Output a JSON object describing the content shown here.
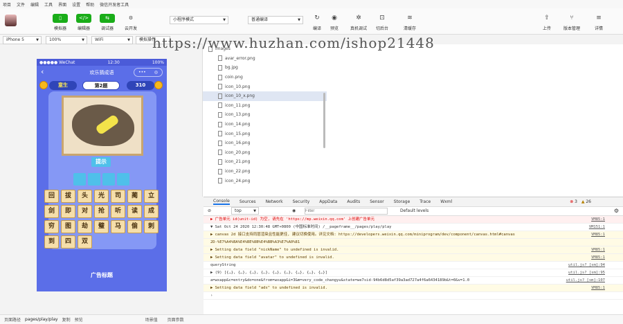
{
  "menu": [
    "项目",
    "文件",
    "编辑",
    "工具",
    "界面",
    "设置",
    "帮助",
    "微信开发者工具"
  ],
  "toolbar": {
    "simulator": "模拟器",
    "editor": "编辑器",
    "debugger": "调试器",
    "cloud": "云开发",
    "mode": "小程序模式",
    "compile_mode": "普通编译",
    "compile": "编译",
    "preview": "预览",
    "real_debug": "真机调试",
    "cut_bg": "切后台",
    "clear_cache": "清缓存",
    "upload": "上传",
    "version": "版本管理",
    "details": "详情"
  },
  "sim_bar": {
    "device": "iPhone 5",
    "zoom": "100%",
    "network": "WiFi",
    "mode": "模拟操作"
  },
  "phone": {
    "carrier": "●●●●● WeChat",
    "time": "12:30",
    "battery": "100%",
    "title": "欢乐猜成语",
    "level_name": "童生",
    "level": "第2题",
    "coins": "310",
    "hint": "提示",
    "chars": [
      "回",
      "拔",
      "头",
      "光",
      "司",
      "蔺",
      "立",
      "剑",
      "即",
      "对",
      "抢",
      "听",
      "读",
      "成",
      "穷",
      "图",
      "劫",
      "璧",
      "马",
      "偷",
      "刺",
      "到",
      "四",
      "双"
    ],
    "ad": "广告标题"
  },
  "files": [
    "images",
    "avar_error.png",
    "bg.jpg",
    "coin.png",
    "icon_10.png",
    "icon_10_x.png",
    "icon_11.png",
    "icon_13.png",
    "icon_14.png",
    "icon_15.png",
    "icon_16.png",
    "icon_20.png",
    "icon_21.png",
    "icon_22.png",
    "icon_24.png"
  ],
  "watermark": "https://www.huzhan.com/ishop21448",
  "devtools": {
    "tabs": [
      "Console",
      "Sources",
      "Network",
      "Security",
      "AppData",
      "Audits",
      "Sensor",
      "Storage",
      "Trace",
      "Wxml"
    ],
    "context": "top",
    "filter_placeholder": "Filter",
    "levels": "Default levels",
    "errors": "3",
    "warnings": "26",
    "logs": [
      {
        "text": "▶ 广告单元 id(unit-id) 为空, 请先在 'https://mp.weixin.qq.com' 上创建广告单元",
        "src": "VM85:1",
        "kind": "err"
      },
      {
        "text": "▼ Sat Oct 24 2020 12:30:48 GMT+0800 (中国标准时间) /__pageframe__/pages/play/play",
        "src": "VM151:1",
        "kind": "normal"
      },
      {
        "text": "  ▶ canvas 2d 接口支持同层渲染且性能更佳, 建议切换使用。详见文档: https://developers.weixin.qq.com/miniprogram/dev/component/canvas.html#canvas",
        "src": "VM85:1",
        "kind": "warn"
      },
      {
        "text": "  2D-%E7%A4%BA%E4%BE%8B%E4%BB%A3%E7%A0%81",
        "src": "",
        "kind": "warn"
      },
      {
        "text": "▶ Setting data field \"nickName\" to undefined is invalid.",
        "src": "VM85:1",
        "kind": "warn"
      },
      {
        "text": "▶ Setting data field \"avatar\" to undefined is invalid.",
        "src": "VM85:1",
        "kind": "warn"
      },
      {
        "text": "queryString",
        "src": "util.js? [sm]:94",
        "kind": "normal"
      },
      {
        "text": "▶ (9) [{…}, {…}, {…}, {…}, {…}, {…}, {…}, {…}, {…}]",
        "src": "util.js? [sm]:95",
        "kind": "normal"
      },
      {
        "text": "a=wxapp&c=entry&do=one&from=wxapp&i=3&m=very_code_changyu&state=we7sid-94b6d8d5af39a3ad727a4f6a6434189b&t=0&v=1.0",
        "src": "util.js? [sm]:107",
        "kind": "normal"
      },
      {
        "text": "▶ Setting data field \"ads\" to undefined is invalid.",
        "src": "VM85:1",
        "kind": "warn"
      },
      {
        "text": "›",
        "src": "",
        "kind": "normal"
      }
    ]
  },
  "bottombar": {
    "path_label": "页面路径",
    "path": "pages/play/play",
    "copy": "复制",
    "preview": "预览",
    "scene": "场景值",
    "params": "页面参数"
  }
}
